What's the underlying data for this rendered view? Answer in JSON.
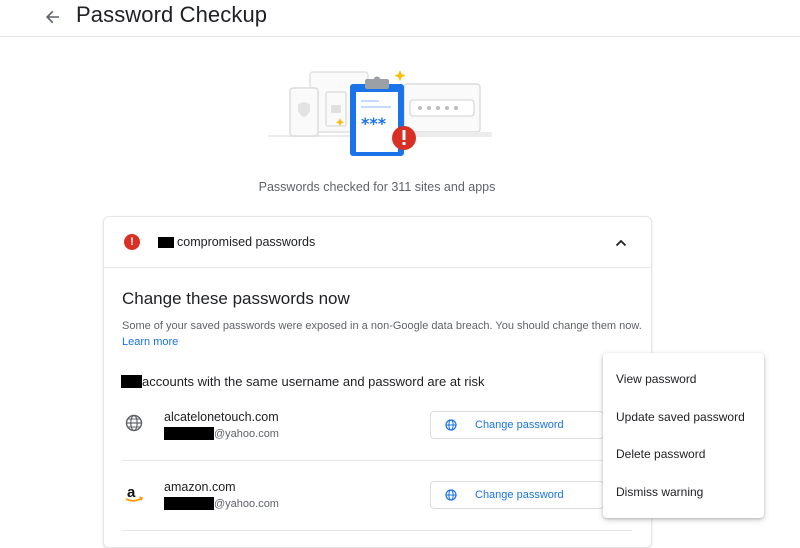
{
  "header": {
    "title": "Password Checkup",
    "back_icon": "arrow-back-icon"
  },
  "summary": {
    "text": "Passwords checked for 311 sites and apps"
  },
  "card": {
    "header_label": "compromised passwords",
    "section_title": "Change these passwords now",
    "description": "Some of your saved passwords were exposed in a non-Google data breach. You should change them now.",
    "learn_more": "Learn more",
    "risk_text": "accounts with the same username and password are at risk",
    "rows": [
      {
        "site": "alcatelonetouch.com",
        "user_suffix": "@yahoo.com",
        "icon": "globe-icon",
        "button_label": "Change password"
      },
      {
        "site": "amazon.com",
        "user_suffix": "@yahoo.com",
        "icon": "amazon-logo-icon",
        "button_label": "Change password"
      }
    ]
  },
  "menu": {
    "items": [
      "View password",
      "Update saved password",
      "Delete password",
      "Dismiss warning"
    ]
  },
  "colors": {
    "accent": "#1a73e8",
    "danger": "#d93025",
    "star": "#fbbc04",
    "clipboard": "#1a73e8"
  }
}
